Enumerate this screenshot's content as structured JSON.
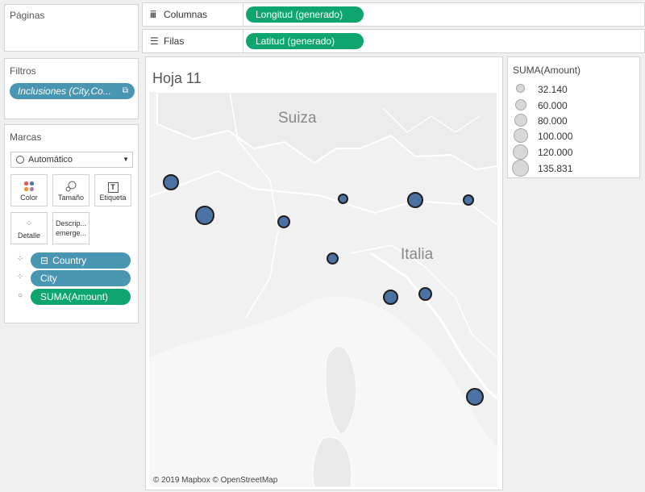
{
  "pages": {
    "title": "Páginas"
  },
  "columns": {
    "label": "Columnas",
    "icon": "columns-icon",
    "pill": "Longitud (generado)"
  },
  "rows": {
    "label": "Filas",
    "icon": "rows-icon",
    "pill": "Latitud (generado)"
  },
  "filters": {
    "title": "Filtros",
    "pill": "Inclusiones (City,Co..."
  },
  "marks": {
    "title": "Marcas",
    "type": "Automático",
    "buttons": {
      "color": "Color",
      "size": "Tamaño",
      "label": "Etiqueta",
      "detail": "Detalle",
      "tooltip": "Descrip... emerge..."
    },
    "fields": [
      {
        "name": "Country",
        "role": "detail-icon",
        "prefix": "⊟"
      },
      {
        "name": "City",
        "role": "detail-icon"
      },
      {
        "name": "SUMA(Amount)",
        "role": "size-icon"
      }
    ]
  },
  "view": {
    "title": "Hoja 11",
    "map_labels": {
      "suiza": "Suiza",
      "italia": "Italia"
    },
    "attribution": "© 2019 Mapbox © OpenStreetMap",
    "mark_color": "#4c72a4"
  },
  "legend": {
    "title": "SUMA(Amount)",
    "entries": [
      "32.140",
      "60.000",
      "80.000",
      "100.000",
      "120.000",
      "135.831"
    ]
  }
}
